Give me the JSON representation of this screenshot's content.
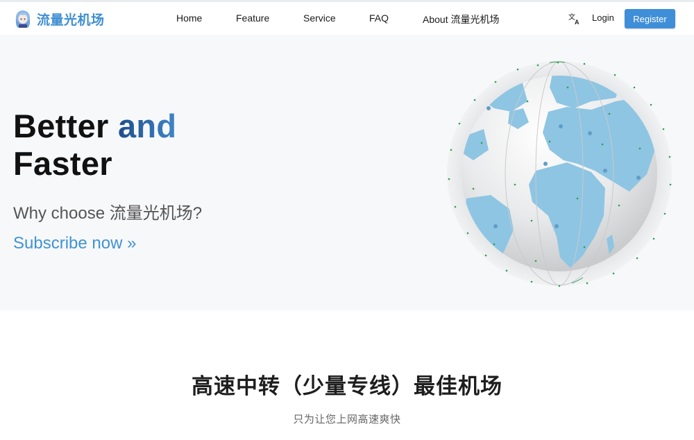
{
  "header": {
    "brand_name": "流量光机场",
    "nav": [
      "Home",
      "Feature",
      "Service",
      "FAQ",
      "About 流量光机场"
    ],
    "login_label": "Login",
    "register_label": "Register"
  },
  "hero": {
    "title_word_1": "Better",
    "title_word_2": "and",
    "title_word_3": "Faster",
    "subtitle": "Why choose 流量光机场?",
    "cta": "Subscribe now »"
  },
  "section": {
    "title": "高速中转（少量专线）最佳机场",
    "subtitle": "只为让您上网高速爽快"
  },
  "colors": {
    "accent": "#3f8ed8",
    "brand": "#3f8fd1",
    "title_gradient_start": "#1f4e8c",
    "title_gradient_end": "#3e86c8",
    "hero_background": "#f7f8fa",
    "continent": "#8ec5e3",
    "globe_dots": "#2f9e4f"
  },
  "icons": {
    "logo": "anime-character-logo",
    "language": "translate-icon",
    "hero_image": "globe-illustration"
  }
}
